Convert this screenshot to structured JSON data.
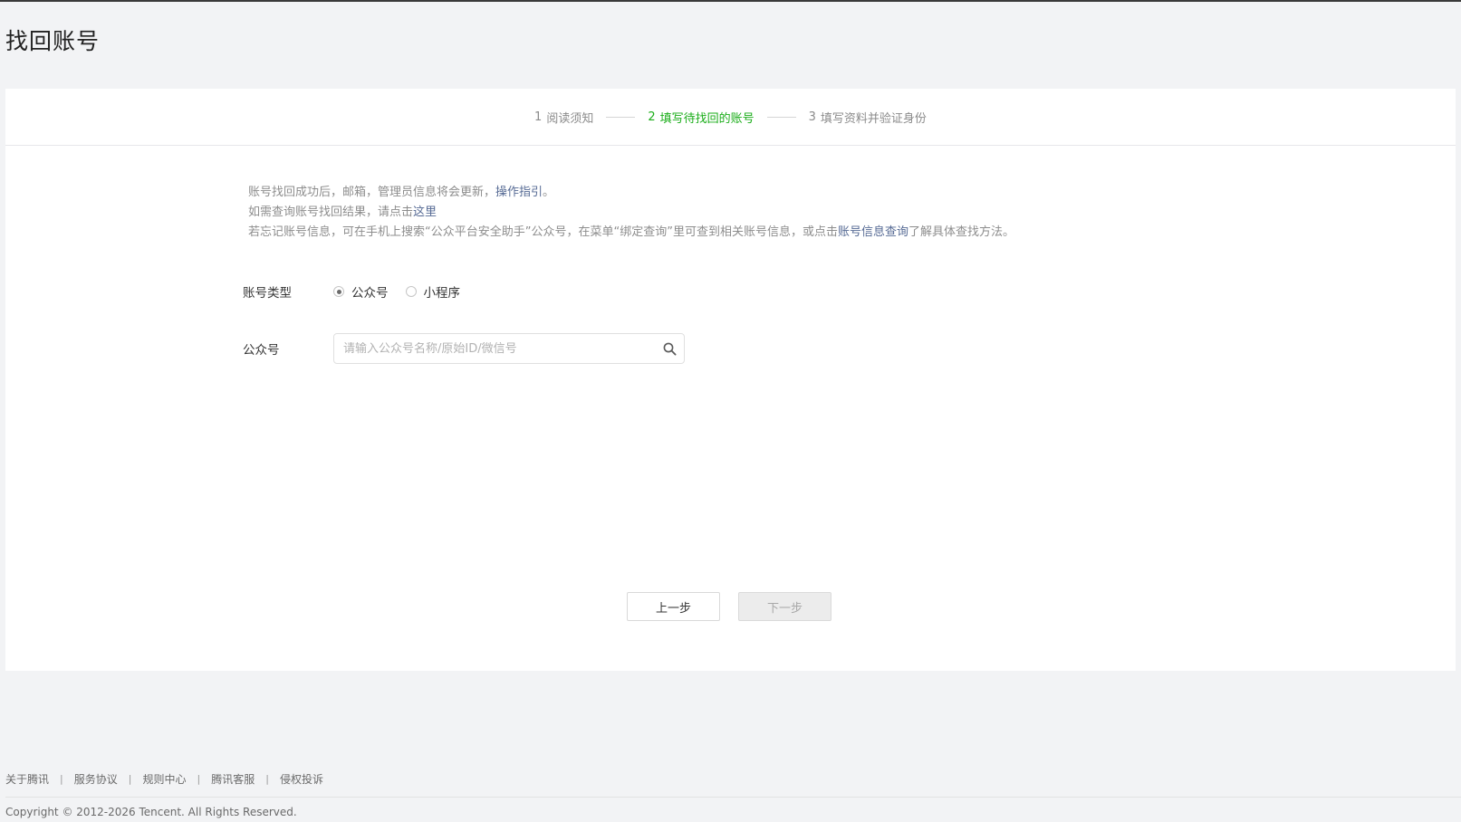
{
  "page": {
    "title": "找回账号"
  },
  "steps": [
    {
      "num": "1",
      "label": "阅读须知",
      "active": false
    },
    {
      "num": "2",
      "label": "填写待找回的账号",
      "active": true
    },
    {
      "num": "3",
      "label": "填写资料并验证身份",
      "active": false
    }
  ],
  "colors": {
    "accent": "#1aad19",
    "link": "#576b95"
  },
  "notice": {
    "line1_text": "账号找回成功后，邮箱，管理员信息将会更新，",
    "line1_link": "操作指引",
    "line1_end": "。",
    "line2_text": "如需查询账号找回结果，请点击",
    "line2_link": "这里",
    "line3_text": "若忘记账号信息，可在手机上搜索“公众平台安全助手”公众号，在菜单“绑定查询”里可查到相关账号信息，或点击",
    "line3_link": "账号信息查询",
    "line3_end": "了解具体查找方法。"
  },
  "form": {
    "type_label": "账号类型",
    "options": [
      {
        "label": "公众号",
        "checked": true
      },
      {
        "label": "小程序",
        "checked": false
      }
    ],
    "account_label": "公众号",
    "search_placeholder": "请输入公众号名称/原始ID/微信号",
    "search_value": "",
    "search_icon": "search-icon"
  },
  "buttons": {
    "prev": "上一步",
    "next": "下一步"
  },
  "footer": {
    "links": [
      "关于腾讯",
      "服务协议",
      "规则中心",
      "腾讯客服",
      "侵权投诉"
    ],
    "separator": "|",
    "copyright": "Copyright © 2012-2026 Tencent. All Rights Reserved."
  }
}
